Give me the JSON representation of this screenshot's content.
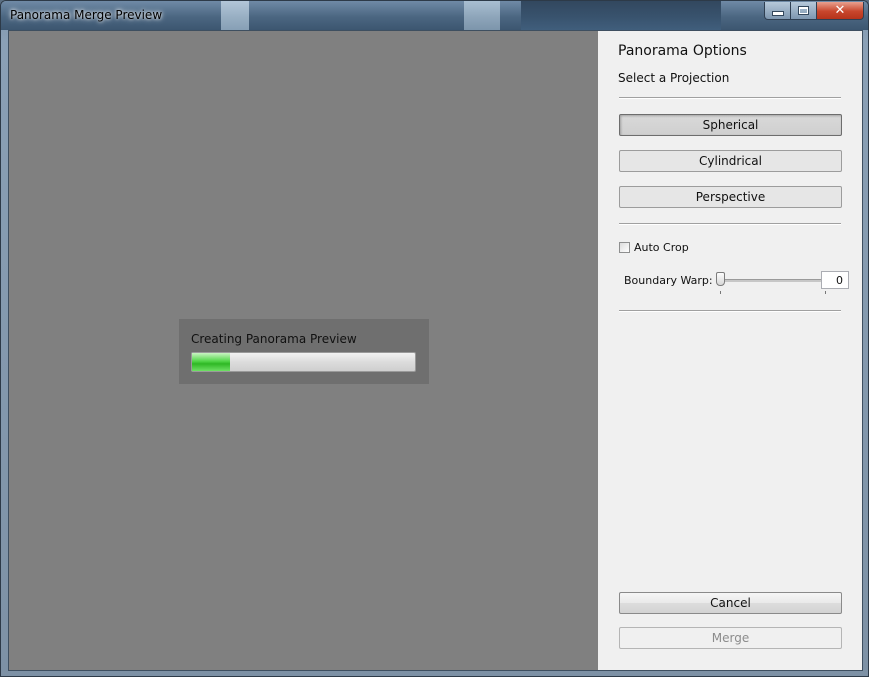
{
  "window": {
    "title": "Panorama Merge Preview"
  },
  "progress": {
    "label": "Creating Panorama Preview",
    "fraction": 0.17
  },
  "sidebar": {
    "heading": "Panorama Options",
    "subheading": "Select a Projection",
    "projections": [
      {
        "label": "Spherical",
        "selected": true
      },
      {
        "label": "Cylindrical",
        "selected": false
      },
      {
        "label": "Perspective",
        "selected": false
      }
    ],
    "auto_crop": {
      "label": "Auto Crop",
      "checked": false
    },
    "boundary_warp": {
      "label": "Boundary Warp:",
      "value": "0"
    },
    "cancel_label": "Cancel",
    "merge_label": "Merge"
  },
  "icons": {
    "minimize": "minimize-icon",
    "maximize": "maximize-icon",
    "close": "close-icon"
  }
}
